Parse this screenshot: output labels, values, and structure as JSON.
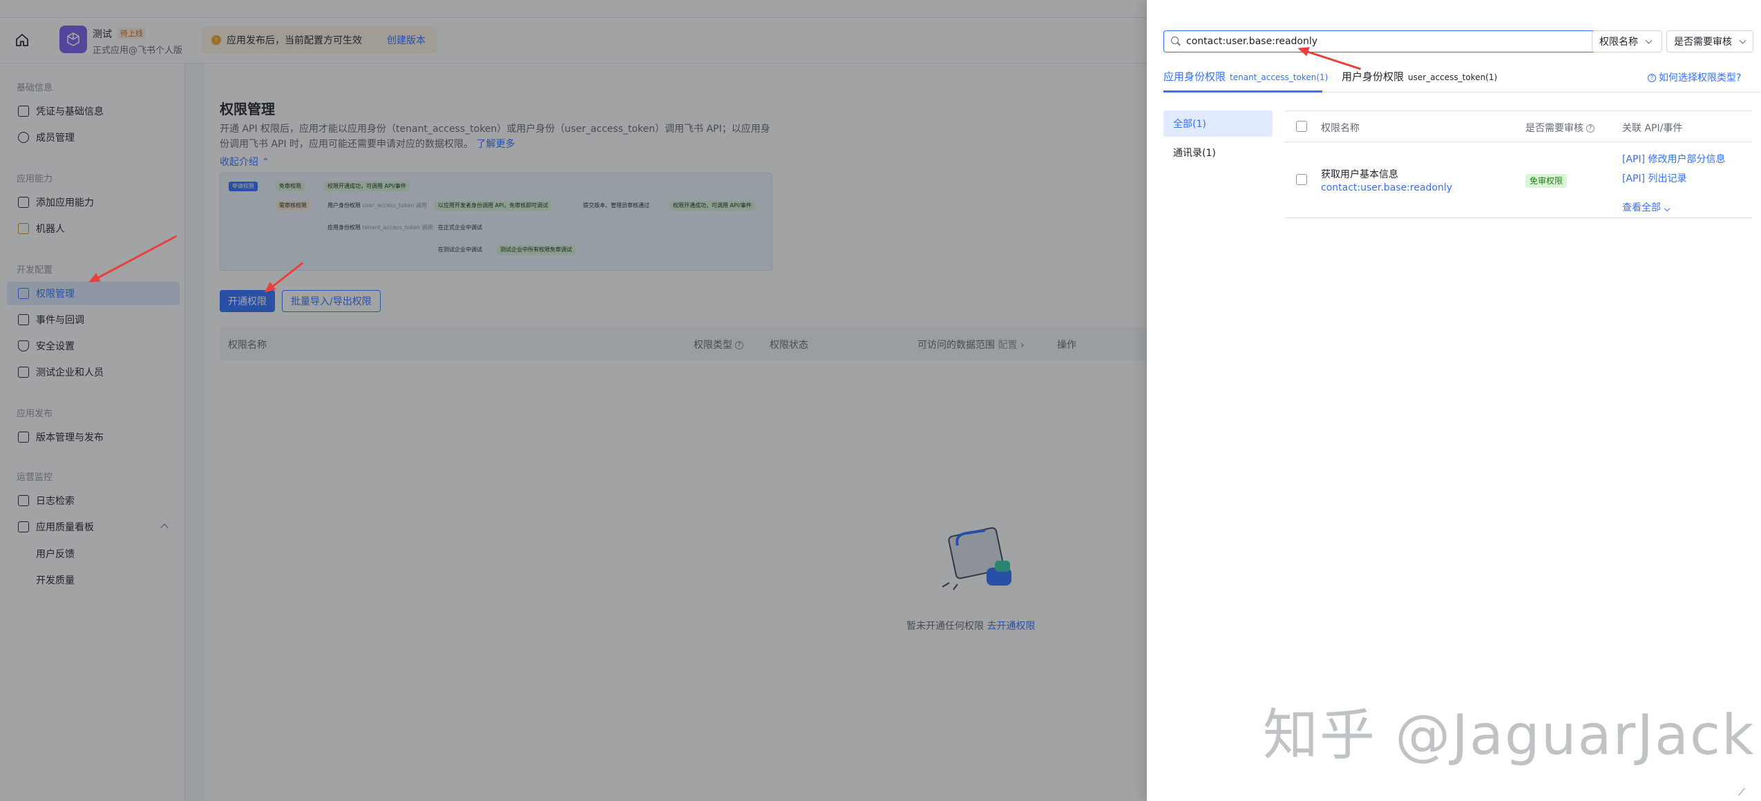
{
  "header": {
    "app_name": "测试",
    "app_tag": "待上线",
    "app_sub": "正式应用@飞书个人版",
    "notice_text": "应用发布后，当前配置方可生效",
    "notice_link": "创建版本"
  },
  "sidebar": {
    "groups": {
      "basic": "基础信息",
      "ability": "应用能力",
      "dev": "开发配置",
      "publish": "应用发布",
      "ops": "运营监控"
    },
    "items": {
      "credentials": "凭证与基础信息",
      "members": "成员管理",
      "add_ability": "添加应用能力",
      "robot": "机器人",
      "permissions": "权限管理",
      "events": "事件与回调",
      "security": "安全设置",
      "test_company": "测试企业和人员",
      "version": "版本管理与发布",
      "log_search": "日志检索",
      "quality": "应用质量看板",
      "feedback": "用户反馈",
      "dev_quality": "开发质量"
    }
  },
  "main": {
    "title": "权限管理",
    "desc": "开通 API 权限后，应用才能以应用身份（tenant_access_token）或用户身份（user_access_token）调用飞书 API；以应用身份调用飞书 API 时，应用可能还需要申请对应的数据权限。",
    "learn_more": "了解更多",
    "collapse": "收起介绍",
    "flow": {
      "apply": "申请权限",
      "free": "免审权限",
      "free_result": "权限开通成功，可调用 API/事件",
      "need_review": "需审核权限",
      "user_token": "用户身份权限",
      "user_token_sub": "user_access_token 调用",
      "user_step": "以应用开发者身份调用 API，免审核即可调试",
      "submit": "提交版本、管理员审核通过",
      "result2": "权限开通成功，可调用 API/事件",
      "app_token": "应用身份权限",
      "app_token_sub": "tenant_access_token 调用",
      "formal": "在正式企业中调试",
      "test": "在测试企业中调试",
      "test_result": "测试企业中所有权限免审调试"
    },
    "btn_open": "开通权限",
    "btn_batch": "批量导入/导出权限",
    "columns": {
      "name": "权限名称",
      "type": "权限类型",
      "status": "权限状态",
      "scope": "可访问的数据范围",
      "scope_config": "配置",
      "ops": "操作"
    },
    "empty_text": "暂未开通任何权限",
    "empty_link": "去开通权限"
  },
  "drawer": {
    "search_value": "contact:user.base:readonly",
    "filter1": "权限名称",
    "filter2": "是否需要审核",
    "tab1_label": "应用身份权限",
    "tab1_sub": "tenant_access_token(1)",
    "tab2_label": "用户身份权限",
    "tab2_sub": "user_access_token(1)",
    "help": "如何选择权限类型?",
    "categories": [
      "全部(1)",
      "通讯录(1)"
    ],
    "table_head": {
      "name": "权限名称",
      "review": "是否需要审核",
      "api": "关联 API/事件"
    },
    "rows": [
      {
        "name": "获取用户基本信息",
        "scope": "contact:user.base:readonly",
        "badge": "免审权限",
        "apis": [
          "[API] 修改用户部分信息",
          "[API] 列出记录"
        ],
        "view_all": "查看全部"
      }
    ]
  },
  "watermark": "知乎 @JaguarJack",
  "colors": {
    "accent": "#3370ff",
    "annotation_arrow": "#e8413b",
    "badge_bg": "#d9f5d6"
  }
}
